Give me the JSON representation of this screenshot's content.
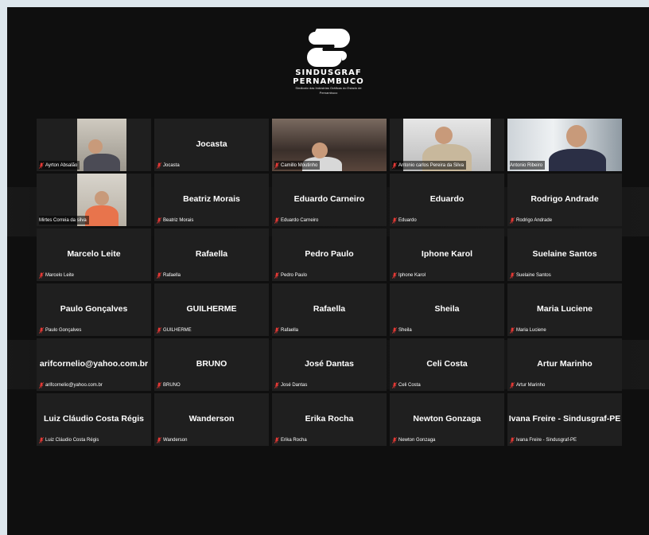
{
  "logo": {
    "name_line1": "SINDUSGRAF",
    "name_line2": "PERNAMBUCO",
    "tagline": "Sindicato das Indústrias Gráficas do Estado de Pernambuco"
  },
  "colors": {
    "active_border": "#b9d84a",
    "muted_icon": "#e53935",
    "tile_bg": "#1f1f1f"
  },
  "participants": [
    {
      "name": "Ayrton Absalão",
      "video": true,
      "muted": true
    },
    {
      "name": "Jocasta",
      "video": false,
      "muted": true
    },
    {
      "name": "Camillo Moutinho",
      "video": true,
      "muted": true
    },
    {
      "name": "Antonio carlos Pereira da Silva",
      "video": true,
      "muted": true
    },
    {
      "name": "Antonio Ribeiro",
      "video": true,
      "muted": false,
      "active": true
    },
    {
      "name": "Mirtes Correia da silva",
      "video": true,
      "muted": false
    },
    {
      "name": "Beatriz Morais",
      "video": false,
      "muted": true
    },
    {
      "name": "Eduardo Carneiro",
      "video": false,
      "muted": true
    },
    {
      "name": "Eduardo",
      "video": false,
      "muted": true
    },
    {
      "name": "Rodrigo Andrade",
      "video": false,
      "muted": true
    },
    {
      "name": "Marcelo Leite",
      "video": false,
      "muted": true
    },
    {
      "name": "Rafaella",
      "video": false,
      "muted": true
    },
    {
      "name": "Pedro Paulo",
      "video": false,
      "muted": true
    },
    {
      "name": "Iphone Karol",
      "video": false,
      "muted": true
    },
    {
      "name": "Suelaine Santos",
      "video": false,
      "muted": true
    },
    {
      "name": "Paulo Gonçalves",
      "video": false,
      "muted": true
    },
    {
      "name": "GUILHERME",
      "video": false,
      "muted": true
    },
    {
      "name": "Rafaella",
      "video": false,
      "muted": true
    },
    {
      "name": "Sheila",
      "video": false,
      "muted": true
    },
    {
      "name": "Maria Luciene",
      "video": false,
      "muted": true
    },
    {
      "name": "arifcornelio@yahoo.com.br",
      "video": false,
      "muted": true
    },
    {
      "name": "BRUNO",
      "video": false,
      "muted": true
    },
    {
      "name": "José Dantas",
      "video": false,
      "muted": true
    },
    {
      "name": "Celi Costa",
      "video": false,
      "muted": true
    },
    {
      "name": "Artur Marinho",
      "video": false,
      "muted": true
    },
    {
      "name": "Luiz Cláudio Costa Régis",
      "video": false,
      "muted": true
    },
    {
      "name": "Wanderson",
      "video": false,
      "muted": true
    },
    {
      "name": "Erika Rocha",
      "video": false,
      "muted": true
    },
    {
      "name": "Newton Gonzaga",
      "video": false,
      "muted": true
    },
    {
      "name": "Ivana Freire - Sindusgraf-PE",
      "video": false,
      "muted": true
    }
  ]
}
